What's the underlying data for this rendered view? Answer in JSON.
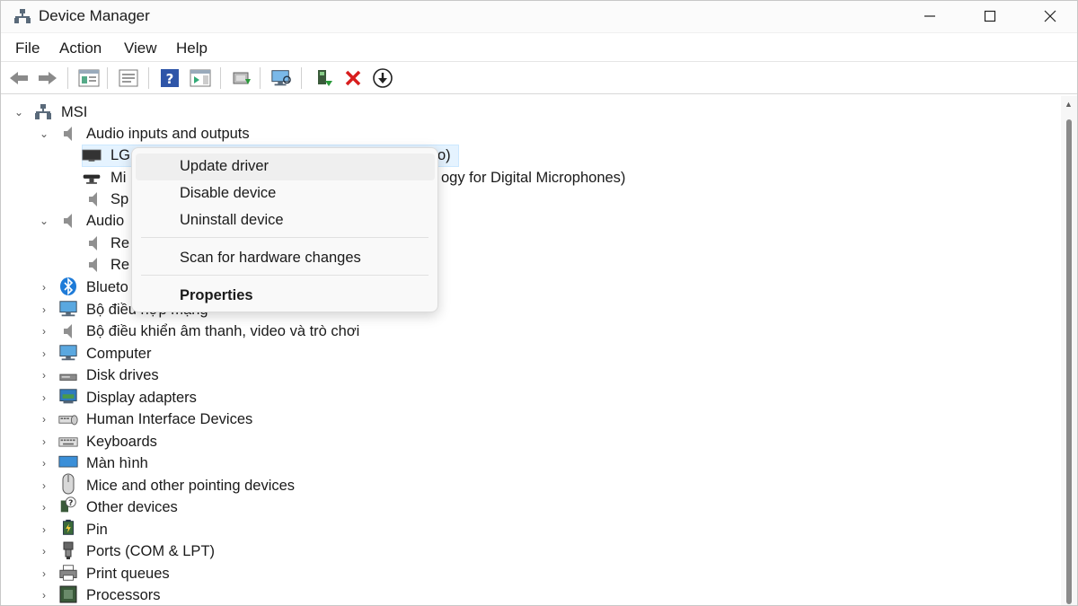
{
  "window": {
    "title": "Device Manager",
    "controls": {
      "minimize": "—",
      "maximize": "☐",
      "close": "✕"
    }
  },
  "menu": {
    "items": [
      "File",
      "Action",
      "View",
      "Help"
    ]
  },
  "toolbar": {
    "buttons": [
      "back-icon",
      "forward-icon",
      "console-tree-icon",
      "properties-icon",
      "help-icon",
      "action-pane-icon",
      "update-driver-icon",
      "scan-hardware-icon",
      "enable-device-icon",
      "uninstall-device-icon",
      "download-icon"
    ]
  },
  "tree": {
    "root": {
      "label": "MSI",
      "chevron": "⌄"
    },
    "audio_inputs": {
      "label": "Audio inputs and outputs",
      "chevron": "⌄",
      "children": [
        "LG",
        "Mi",
        "Sp"
      ],
      "tail_text": [
        "o)",
        "ogy for Digital Microphones)"
      ]
    },
    "audio_processing": {
      "label": "Audio",
      "chevron": "⌄",
      "children": [
        "Re",
        "Re"
      ]
    },
    "categories": [
      {
        "label": "Blueto",
        "icon": "bluetooth-icon"
      },
      {
        "label": "Bộ điều hợp mạng",
        "icon": "network-adapter-icon"
      },
      {
        "label": "Bộ điều khiển âm thanh, video và trò chơi",
        "icon": "sound-controller-icon"
      },
      {
        "label": "Computer",
        "icon": "computer-icon"
      },
      {
        "label": "Disk drives",
        "icon": "disk-drive-icon"
      },
      {
        "label": "Display adapters",
        "icon": "display-adapter-icon"
      },
      {
        "label": "Human Interface Devices",
        "icon": "hid-icon"
      },
      {
        "label": "Keyboards",
        "icon": "keyboard-icon"
      },
      {
        "label": "Màn hình",
        "icon": "monitor-icon"
      },
      {
        "label": "Mice and other pointing devices",
        "icon": "mouse-icon"
      },
      {
        "label": "Other devices",
        "icon": "other-devices-icon"
      },
      {
        "label": "Pin",
        "icon": "battery-icon"
      },
      {
        "label": "Ports (COM & LPT)",
        "icon": "port-icon"
      },
      {
        "label": "Print queues",
        "icon": "printer-icon"
      },
      {
        "label": "Processors",
        "icon": "processor-icon"
      }
    ],
    "chevron_collapsed": "›"
  },
  "context_menu": {
    "update_driver": "Update driver",
    "disable_device": "Disable device",
    "uninstall_device": "Uninstall device",
    "scan_hardware": "Scan for hardware changes",
    "properties": "Properties"
  },
  "colors": {
    "selection": "#e5f3ff",
    "toolbar_red": "#d81e1e",
    "accent_blue": "#1e7bd8"
  }
}
